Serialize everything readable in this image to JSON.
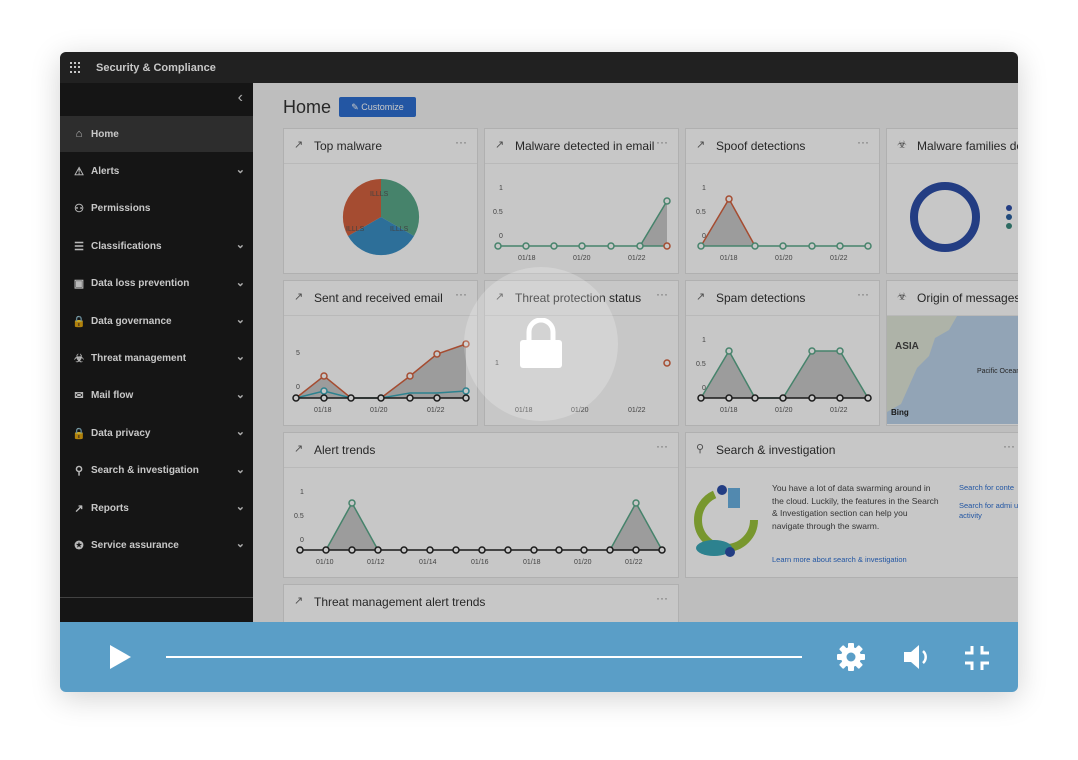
{
  "app": {
    "title": "Security & Compliance"
  },
  "sidebar": {
    "items": [
      {
        "label": "Home",
        "icon": "home-icon",
        "glyph": "⌂",
        "chevron": false,
        "active": true
      },
      {
        "label": "Alerts",
        "icon": "alert-icon",
        "glyph": "⚠",
        "chevron": true
      },
      {
        "label": "Permissions",
        "icon": "permissions-icon",
        "glyph": "⚇",
        "chevron": false
      },
      {
        "label": "Classifications",
        "icon": "classifications-icon",
        "glyph": "☰",
        "chevron": true
      },
      {
        "label": "Data loss prevention",
        "icon": "dlp-icon",
        "glyph": "▣",
        "chevron": true
      },
      {
        "label": "Data governance",
        "icon": "lock-icon",
        "glyph": "🔒",
        "chevron": true
      },
      {
        "label": "Threat management",
        "icon": "biohazard-icon",
        "glyph": "☣",
        "chevron": true
      },
      {
        "label": "Mail flow",
        "icon": "mail-icon",
        "glyph": "✉",
        "chevron": true
      },
      {
        "label": "Data privacy",
        "icon": "lock-icon",
        "glyph": "🔒",
        "chevron": true
      },
      {
        "label": "Search & investigation",
        "icon": "search-icon",
        "glyph": "⚲",
        "chevron": true
      },
      {
        "label": "Reports",
        "icon": "chart-icon",
        "glyph": "↗",
        "chevron": true
      },
      {
        "label": "Service assurance",
        "icon": "ribbon-icon",
        "glyph": "✪",
        "chevron": true
      }
    ]
  },
  "main": {
    "page_title": "Home",
    "customize_label": "Customize",
    "cards": {
      "top_malware": {
        "title": "Top malware",
        "slice_labels": [
          "ILLLS",
          "ILLLS",
          "ILLLS"
        ]
      },
      "malware_email": {
        "title": "Malware detected in email",
        "y_ticks": [
          "1",
          "0.5",
          "0"
        ],
        "x_ticks": [
          "01/18",
          "01/20",
          "01/22"
        ]
      },
      "spoof": {
        "title": "Spoof detections",
        "y_ticks": [
          "1",
          "0.5",
          "0"
        ],
        "x_ticks": [
          "01/18",
          "01/20",
          "01/22"
        ]
      },
      "malware_families": {
        "title": "Malware families de"
      },
      "sent_received": {
        "title": "Sent and received email",
        "y_ticks": [
          "5",
          "0"
        ],
        "x_ticks": [
          "01/18",
          "01/20",
          "01/22"
        ]
      },
      "threat_protection": {
        "title": "Threat protection status",
        "y_ticks": [
          "1"
        ],
        "x_ticks": [
          "01/18",
          "01/20",
          "01/22"
        ]
      },
      "spam": {
        "title": "Spam detections",
        "y_ticks": [
          "1",
          "0.5",
          "0"
        ],
        "x_ticks": [
          "01/18",
          "01/20",
          "01/22"
        ]
      },
      "origin": {
        "title": "Origin of messages",
        "map_region": "ASIA",
        "map_ocean": "Pacific Ocean",
        "map_brand": "Bing"
      },
      "alert_trends": {
        "title": "Alert trends",
        "y_ticks": [
          "1",
          "0.5",
          "0"
        ],
        "x_ticks": [
          "01/10",
          "01/12",
          "01/14",
          "01/16",
          "01/18",
          "01/20",
          "01/22"
        ]
      },
      "search": {
        "title": "Search & investigation",
        "body": "You have a lot of data swarming around in the cloud. Luckily, the features in the Search & Investigation section can help you navigate through the swarm.",
        "learn_more": "Learn more about search & investigation",
        "link1": "Search for conte",
        "link2": "Search for admi user activity"
      },
      "tm_alert_trends": {
        "title": "Threat management alert trends"
      }
    }
  },
  "player": {
    "play_label": "Play",
    "settings_label": "Settings",
    "volume_label": "Volume",
    "fullscreen_label": "Exit full screen",
    "progress": 0
  },
  "colors": {
    "accent": "#2d6fd1",
    "player_bar": "#5a9ec7",
    "series_green": "#5aa88a",
    "series_orange": "#d4623f",
    "series_teal": "#3aa7b8"
  }
}
